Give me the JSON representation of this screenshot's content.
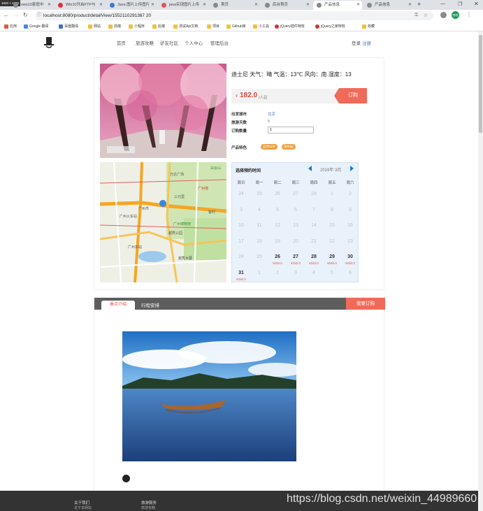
{
  "browser": {
    "corner_badge": "1920 × 1030",
    "tabs": [
      {
        "title": "ows10家庭中"
      },
      {
        "title": "Win10开启FTP与"
      },
      {
        "title": "Java 图片上传图片"
      },
      {
        "title": "java实现图片上传"
      },
      {
        "title": "首页"
      },
      {
        "title": "后台首页"
      },
      {
        "title": "产品信息"
      },
      {
        "title": "产品信息"
      }
    ],
    "url": "localhost:8080/product/detailView/1552110291387 20",
    "bookmarks": [
      "应用",
      "Google 翻译",
      "百度翻译",
      "网站",
      "前端",
      "小程序",
      "后端",
      "测试Api文档",
      "项目",
      "Github库",
      "小工具",
      "jQuery插件特效",
      "jQuery之家特效",
      "收藏"
    ],
    "profile": "哈哈"
  },
  "nav": {
    "items": [
      "首页",
      "旅游攻略",
      "驴友社区",
      "个人中心",
      "管理后台"
    ],
    "login": "登录",
    "register": "注册"
  },
  "product": {
    "title": "迪士尼  天气：晴 气温：13℃ 风向：南 湿度：13",
    "price": "182.0",
    "price_unit": "/人起",
    "currency": "¥",
    "buy_label": "订购",
    "depart_label": "出发城市",
    "depart_value": "北京",
    "days_label": "旅游天数",
    "days_value": "5",
    "qty_label": "订购数量",
    "qty_value": "1",
    "features_label": "产品特色",
    "tags": [
      "自然山水",
      "游乐园"
    ]
  },
  "map": {
    "labels": [
      "万达广场",
      "白云山",
      "广州塔",
      "三元里",
      "广州火车站",
      "广州市",
      "广州博物馆",
      "越秀公园",
      "广州东站",
      "越秀大厦",
      "客村"
    ]
  },
  "calendar": {
    "title": "选择预约时间",
    "month": "2019年 3月",
    "weekdays": [
      "周日",
      "周一",
      "周二",
      "周三",
      "周四",
      "周五",
      "周六"
    ],
    "rows": [
      [
        {
          "d": "24"
        },
        {
          "d": "25"
        },
        {
          "d": "26"
        },
        {
          "d": "27"
        },
        {
          "d": "28"
        },
        {
          "d": "1"
        },
        {
          "d": "2"
        }
      ],
      [
        {
          "d": "3"
        },
        {
          "d": "4"
        },
        {
          "d": "5"
        },
        {
          "d": "6"
        },
        {
          "d": "7"
        },
        {
          "d": "8"
        },
        {
          "d": "9"
        }
      ],
      [
        {
          "d": "10"
        },
        {
          "d": "11"
        },
        {
          "d": "12"
        },
        {
          "d": "13"
        },
        {
          "d": "14"
        },
        {
          "d": "15"
        },
        {
          "d": "16"
        }
      ],
      [
        {
          "d": "17"
        },
        {
          "d": "18"
        },
        {
          "d": "19"
        },
        {
          "d": "20"
        },
        {
          "d": "21"
        },
        {
          "d": "22"
        },
        {
          "d": "23"
        }
      ],
      [
        {
          "d": "24"
        },
        {
          "d": "25"
        },
        {
          "d": "26",
          "p": "¥182.0"
        },
        {
          "d": "27",
          "p": "¥182.0"
        },
        {
          "d": "28",
          "p": "¥182.0"
        },
        {
          "d": "29",
          "p": "¥182.0"
        },
        {
          "d": "30",
          "p": "¥182.0"
        }
      ],
      [
        {
          "d": "31",
          "p": "¥182.0"
        },
        {
          "d": "1"
        },
        {
          "d": "2"
        },
        {
          "d": "3"
        },
        {
          "d": "4"
        },
        {
          "d": "5"
        },
        {
          "d": "6"
        }
      ]
    ]
  },
  "section": {
    "tabs": [
      "景点介绍",
      "行程安排"
    ],
    "order_button": "我要订购"
  },
  "footer": {
    "col1_title": "关于我们",
    "col1_item": "关于本网站",
    "col2_title": "旅游服务",
    "col2_item": "旅游攻略"
  },
  "watermark": "https://blog.csdn.net/weixin_44989660",
  "colors": {
    "accent": "#f06a5a",
    "price": "#e0463c",
    "tag": "#e8a040",
    "calendar_bg": "#e9f1fb",
    "section_bar": "#5d5d5d"
  }
}
